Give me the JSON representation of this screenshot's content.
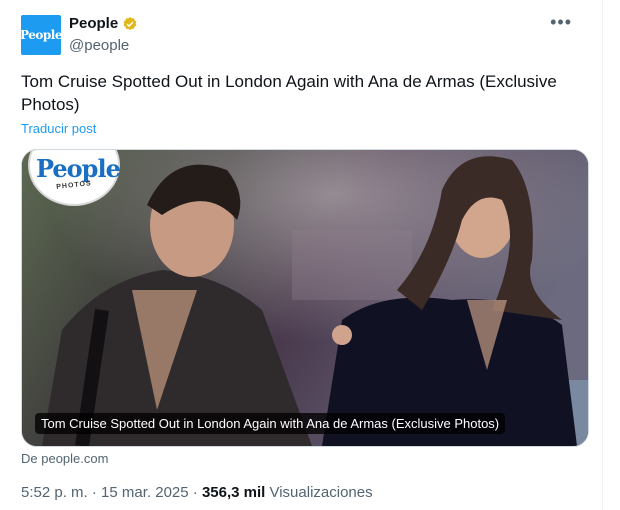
{
  "account": {
    "name": "People",
    "handle": "@people",
    "avatar_text": "People",
    "verified_color": "#e2b719"
  },
  "post": {
    "text": "Tom Cruise Spotted Out in London Again with Ana de Armas (Exclusive Photos)",
    "translate_label": "Traducir post"
  },
  "card": {
    "badge_logo": "People",
    "badge_sub": "PHOTOS",
    "caption": "Tom Cruise Spotted Out in London Again with Ana de Armas (Exclusive Photos)",
    "source": "De people.com"
  },
  "meta": {
    "timestamp": "5:52 p. m. · 15 mar. 2025 · ",
    "views_count": "356,3 mil",
    "views_label": " Visualizaciones"
  },
  "icons": {
    "more": "more-horizontal-icon",
    "verified": "verified-badge-icon"
  },
  "colors": {
    "accent": "#1d9bf0",
    "secondary_text": "#536471",
    "primary_text": "#0f1419"
  }
}
